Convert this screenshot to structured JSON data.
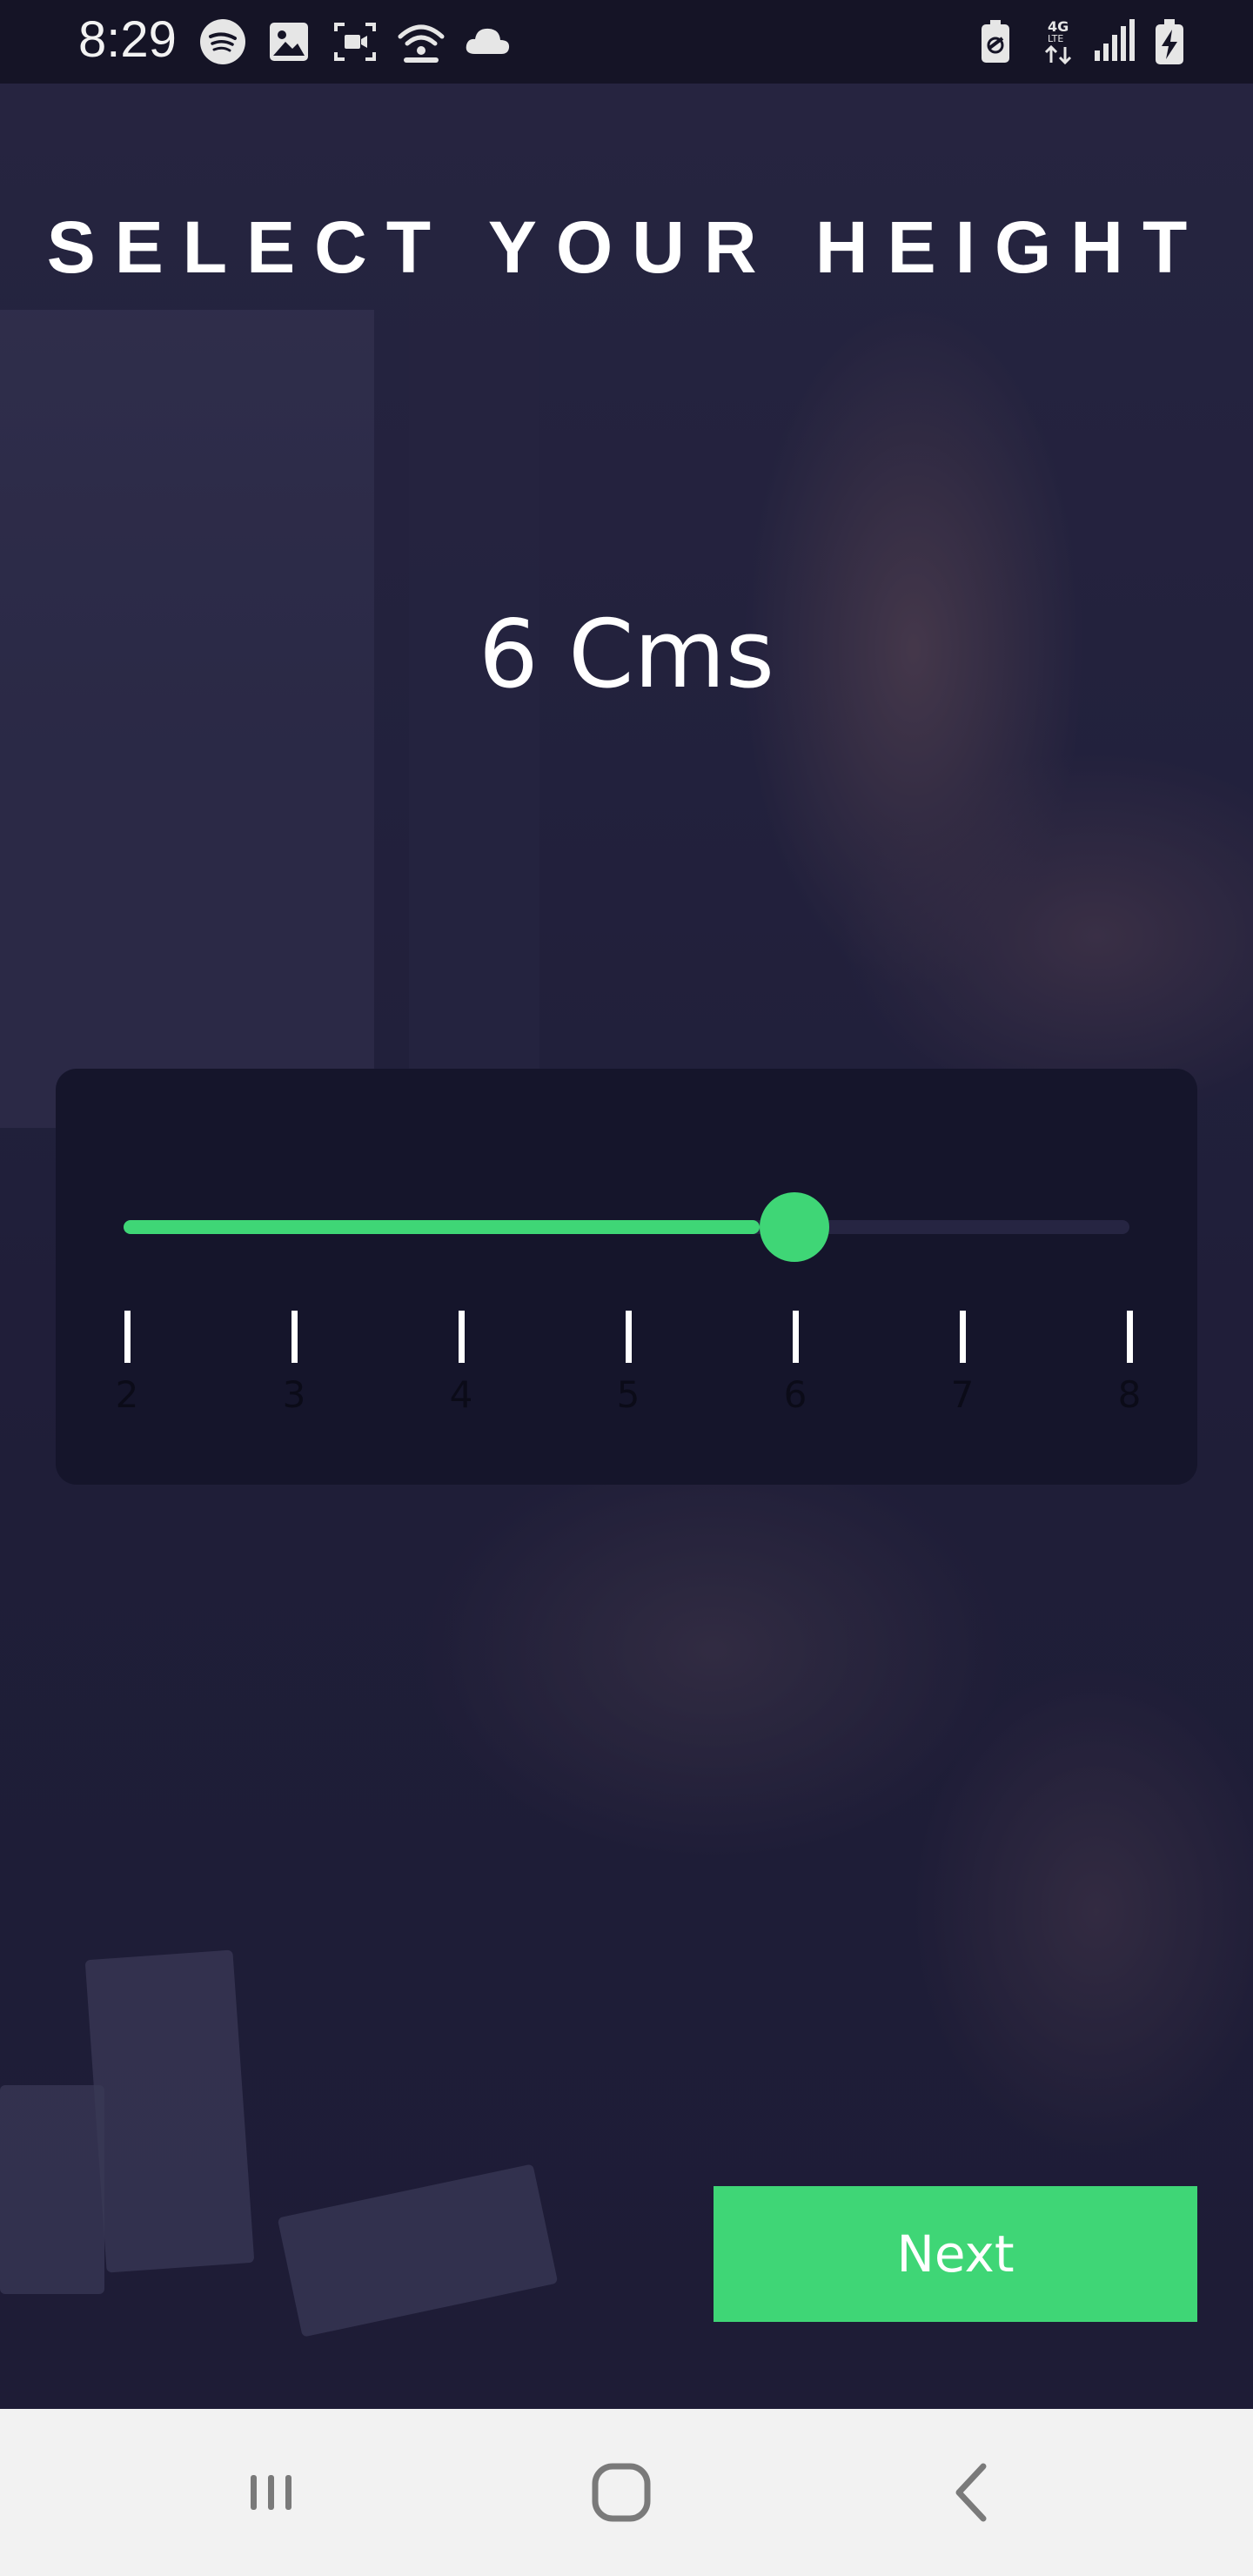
{
  "status_bar": {
    "time": "8:29",
    "left_icons": [
      "spotify-icon",
      "gallery-icon",
      "screen-record-icon",
      "wifi-hotspot-icon",
      "cloud-icon"
    ],
    "right_icons": [
      "battery-saver-icon",
      "4g-lte-icon",
      "signal-icon",
      "battery-charging-icon"
    ]
  },
  "screen": {
    "title": "SELECT YOUR HEIGHT",
    "selected_value": "6",
    "unit": "Cms"
  },
  "slider": {
    "min": 2,
    "max": 8,
    "value": 6,
    "tick_labels": [
      "2",
      "3",
      "4",
      "5",
      "6",
      "7",
      "8"
    ],
    "accent_color": "#3fd676"
  },
  "actions": {
    "next_label": "Next"
  },
  "nav_bar": {
    "buttons": [
      "recents-icon",
      "home-icon",
      "back-icon"
    ]
  }
}
